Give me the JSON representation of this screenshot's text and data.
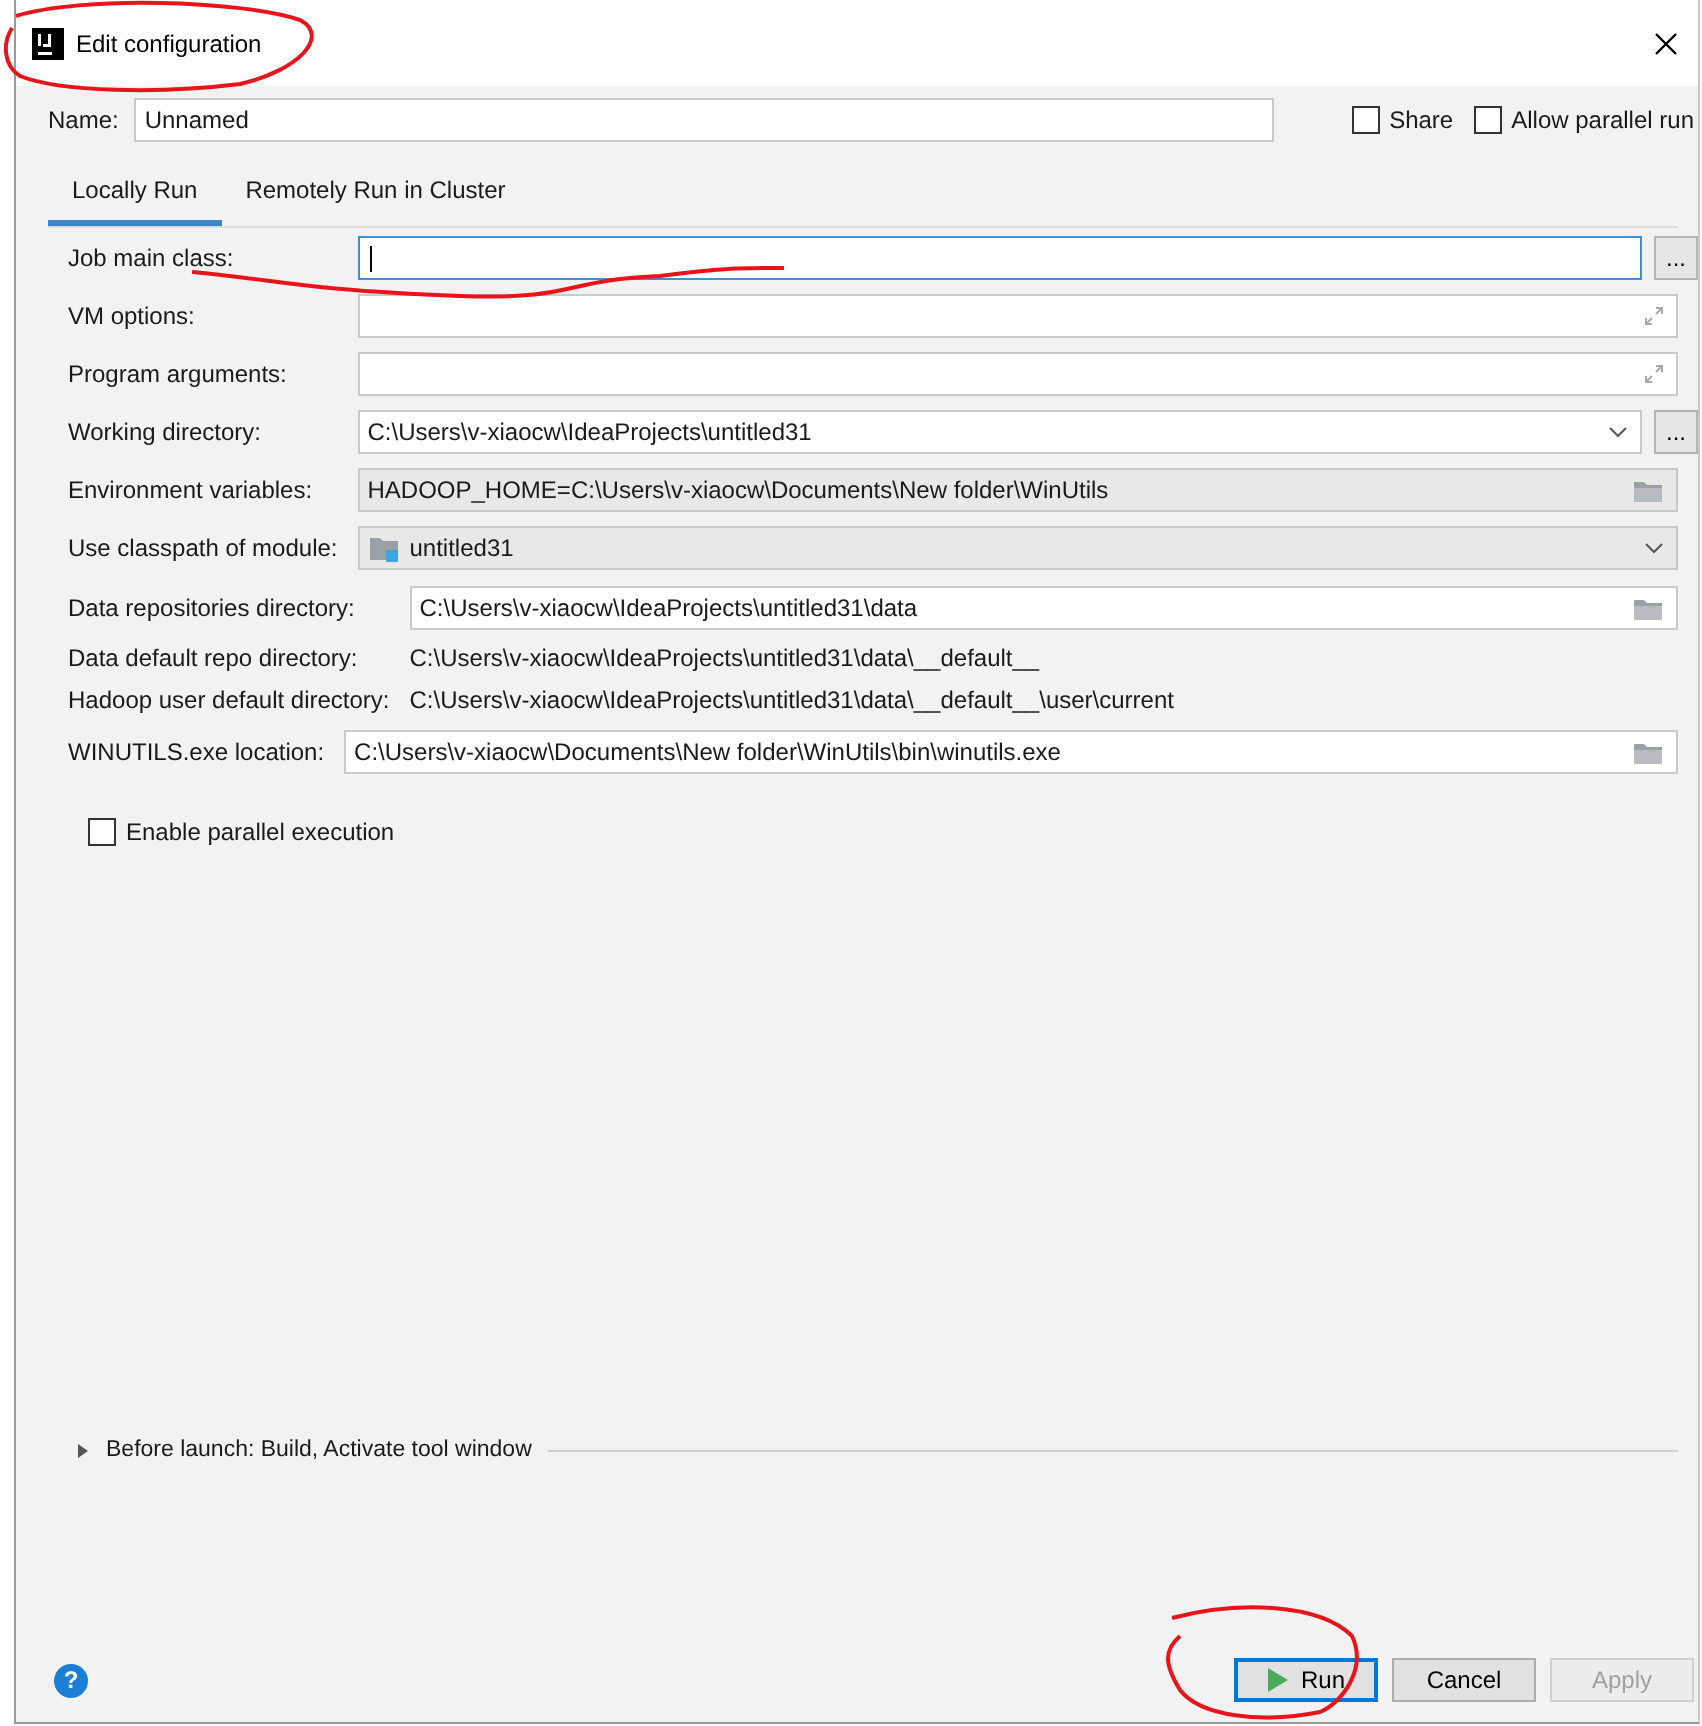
{
  "window": {
    "title": "Edit configuration"
  },
  "name_field": {
    "label": "Name:",
    "value": "Unnamed"
  },
  "options": [
    {
      "label": "Share",
      "checked": false
    },
    {
      "label": "Allow parallel run",
      "checked": false
    }
  ],
  "tabs": [
    {
      "label": "Locally Run",
      "selected": true
    },
    {
      "label": "Remotely Run in Cluster",
      "selected": false
    }
  ],
  "groups": [
    {
      "rows": [
        {
          "kind": "input",
          "label": "Job main class:",
          "value": "",
          "focused": true,
          "button": "..."
        },
        {
          "kind": "expand",
          "label": "VM options:",
          "value": ""
        },
        {
          "kind": "expand",
          "label": "Program arguments:",
          "value": ""
        },
        {
          "kind": "combo",
          "label": "Working directory:",
          "value": "C:\\Users\\v-xiaocw\\IdeaProjects\\untitled31",
          "button": "..."
        },
        {
          "kind": "folder",
          "label": "Environment variables:",
          "value": "HADOOP_HOME=C:\\Users\\v-xiaocw\\Documents\\New folder\\WinUtils",
          "disabled": true
        },
        {
          "kind": "module",
          "label": "Use classpath of module:",
          "value": "untitled31"
        }
      ]
    },
    {
      "rows": [
        {
          "kind": "folder",
          "label": "Data repositories directory:",
          "value": "C:\\Users\\v-xiaocw\\IdeaProjects\\untitled31\\data",
          "disabled": false
        },
        {
          "kind": "info",
          "label": "Data default repo directory:",
          "value": "C:\\Users\\v-xiaocw\\IdeaProjects\\untitled31\\data\\__default__"
        },
        {
          "kind": "info",
          "label": "Hadoop user default directory:",
          "value": "C:\\Users\\v-xiaocw\\IdeaProjects\\untitled31\\data\\__default__\\user\\current"
        }
      ]
    },
    {
      "rows": [
        {
          "kind": "folder",
          "label": "WINUTILS.exe location:",
          "value": "C:\\Users\\v-xiaocw\\Documents\\New folder\\WinUtils\\bin\\winutils.exe",
          "disabled": false
        }
      ]
    }
  ],
  "parallel_execution": {
    "label": "Enable parallel execution",
    "checked": false
  },
  "before_launch": {
    "label": "Before launch: Build, Activate tool window",
    "expanded": false
  },
  "help": "?",
  "buttons": [
    {
      "label": "Run",
      "kind": "primary",
      "disabled": false
    },
    {
      "label": "Cancel",
      "kind": "normal",
      "disabled": false
    },
    {
      "label": "Apply",
      "kind": "normal",
      "disabled": true
    }
  ]
}
